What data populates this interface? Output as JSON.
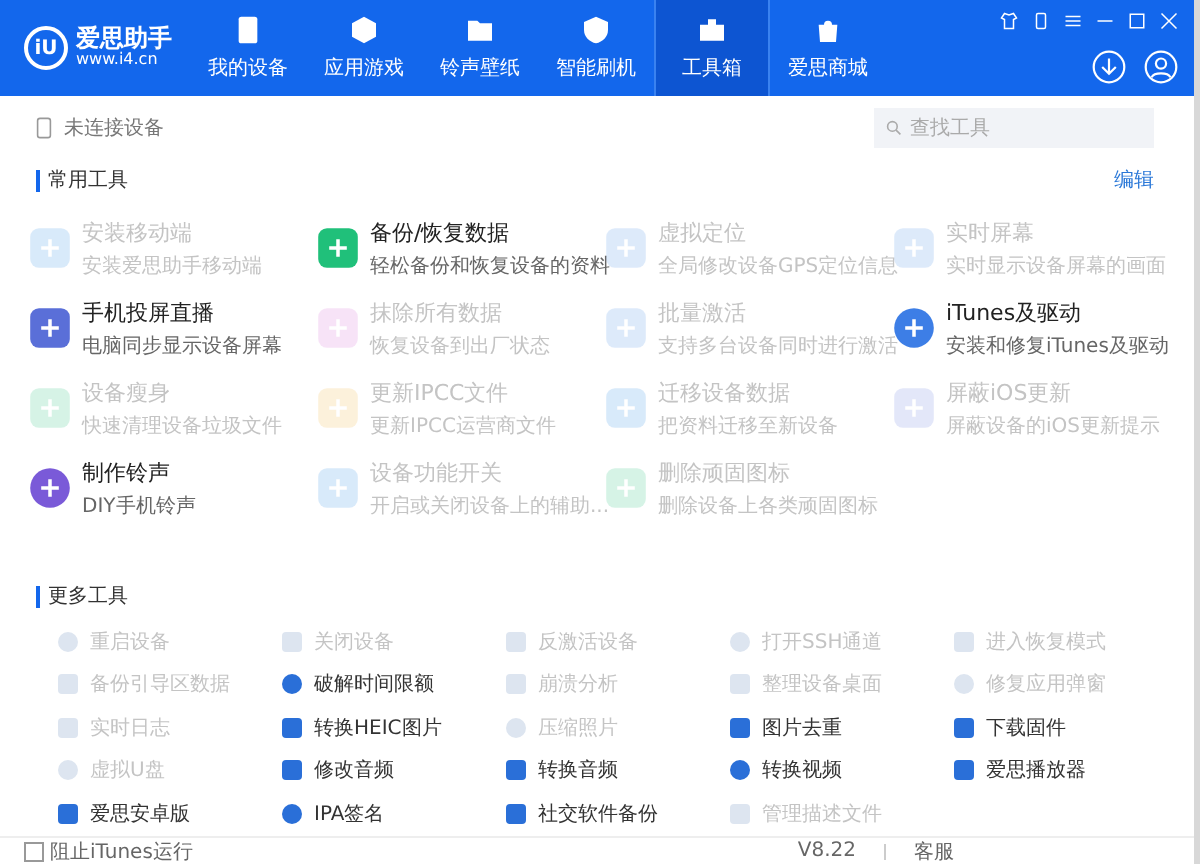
{
  "app": {
    "logo_mark": "iU",
    "name": "爱思助手",
    "url": "www.i4.cn"
  },
  "tabs": [
    {
      "label": "我的设备",
      "selected": false
    },
    {
      "label": "应用游戏",
      "selected": false
    },
    {
      "label": "铃声壁纸",
      "selected": false
    },
    {
      "label": "智能刷机",
      "selected": false
    },
    {
      "label": "工具箱",
      "selected": true
    },
    {
      "label": "爱思商城",
      "selected": false
    }
  ],
  "device_bar": {
    "status": "未连接设备",
    "search": {
      "placeholder": "查找工具"
    }
  },
  "common_tools": {
    "title": "常用工具",
    "edit": "编辑",
    "items": [
      {
        "title": "安装移动端",
        "desc": "安装爱思助手移动端",
        "disabled": true
      },
      {
        "title": "备份/恢复数据",
        "desc": "轻松备份和恢复设备的资料",
        "disabled": false
      },
      {
        "title": "虚拟定位",
        "desc": "全局修改设备GPS定位信息",
        "disabled": true
      },
      {
        "title": "实时屏幕",
        "desc": "实时显示设备屏幕的画面",
        "disabled": true
      },
      {
        "title": "手机投屏直播",
        "desc": "电脑同步显示设备屏幕",
        "disabled": false
      },
      {
        "title": "抹除所有数据",
        "desc": "恢复设备到出厂状态",
        "disabled": true
      },
      {
        "title": "批量激活",
        "desc": "支持多台设备同时进行激活",
        "disabled": true
      },
      {
        "title": "iTunes及驱动",
        "desc": "安装和修复iTunes及驱动",
        "disabled": false
      },
      {
        "title": "设备瘦身",
        "desc": "快速清理设备垃圾文件",
        "disabled": true
      },
      {
        "title": "更新IPCC文件",
        "desc": "更新IPCC运营商文件",
        "disabled": true
      },
      {
        "title": "迁移设备数据",
        "desc": "把资料迁移至新设备",
        "disabled": true
      },
      {
        "title": "屏蔽iOS更新",
        "desc": "屏蔽设备的iOS更新提示",
        "disabled": true
      },
      {
        "title": "制作铃声",
        "desc": "DIY手机铃声",
        "disabled": false
      },
      {
        "title": "设备功能开关",
        "desc": "开启或关闭设备上的辅助...",
        "disabled": true
      },
      {
        "title": "删除顽固图标",
        "desc": "删除设备上各类顽固图标",
        "disabled": true
      }
    ]
  },
  "more_tools": {
    "title": "更多工具",
    "items": [
      {
        "label": "重启设备",
        "disabled": true
      },
      {
        "label": "关闭设备",
        "disabled": true
      },
      {
        "label": "反激活设备",
        "disabled": true
      },
      {
        "label": "打开SSH通道",
        "disabled": true
      },
      {
        "label": "进入恢复模式",
        "disabled": true
      },
      {
        "label": "备份引导区数据",
        "disabled": true
      },
      {
        "label": "破解时间限额",
        "disabled": false
      },
      {
        "label": "崩溃分析",
        "disabled": true
      },
      {
        "label": "整理设备桌面",
        "disabled": true
      },
      {
        "label": "修复应用弹窗",
        "disabled": true
      },
      {
        "label": "实时日志",
        "disabled": true
      },
      {
        "label": "转换HEIC图片",
        "disabled": false
      },
      {
        "label": "压缩照片",
        "disabled": true
      },
      {
        "label": "图片去重",
        "disabled": false
      },
      {
        "label": "下载固件",
        "disabled": false
      },
      {
        "label": "虚拟U盘",
        "disabled": true
      },
      {
        "label": "修改音频",
        "disabled": false
      },
      {
        "label": "转换音频",
        "disabled": false
      },
      {
        "label": "转换视频",
        "disabled": false
      },
      {
        "label": "爱思播放器",
        "disabled": false
      },
      {
        "label": "爱思安卓版",
        "disabled": false
      },
      {
        "label": "IPA签名",
        "disabled": false
      },
      {
        "label": "社交软件备份",
        "disabled": false
      },
      {
        "label": "管理描述文件",
        "disabled": true
      }
    ]
  },
  "status_bar": {
    "block_itunes": {
      "label": "阻止iTunes运行",
      "checked": false
    },
    "version": "V8.22",
    "support": "客服"
  }
}
